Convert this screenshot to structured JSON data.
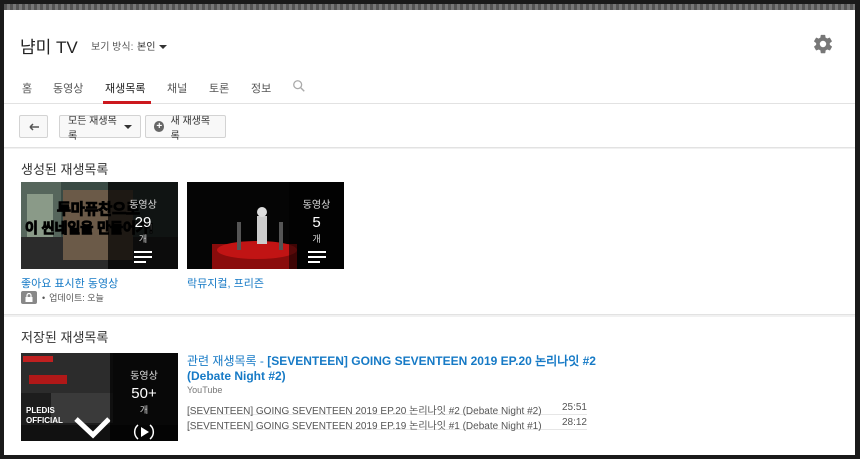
{
  "header": {
    "channel_title": "냠미 TV",
    "view_as_label": "보기 방식:",
    "view_as_value": "본인"
  },
  "tabs": [
    {
      "label": "홈"
    },
    {
      "label": "동영상"
    },
    {
      "label": "재생목록"
    },
    {
      "label": "채널"
    },
    {
      "label": "토론"
    },
    {
      "label": "정보"
    }
  ],
  "toolbar": {
    "all_playlists": "모든 재생목록",
    "new_playlist": "새 재생목록"
  },
  "created": {
    "section_title": "생성된 재생목록",
    "playlists": [
      {
        "title": "좋아요 표시한 동영상",
        "count_label": "동영상",
        "count": "29",
        "unit": "개",
        "meta": "업데이트: 오늘",
        "thumb_caption_1": "투마퓨찬으로",
        "thumb_caption_2": "이 씬네일을 만들어가!"
      },
      {
        "title": "락뮤지컬, 프리즌",
        "count_label": "동영상",
        "count": "5",
        "unit": "개"
      }
    ]
  },
  "saved": {
    "section_title": "저장된 재생목록",
    "playlist": {
      "title_prefix": "관련 재생목록 - ",
      "title_main": "[SEVENTEEN] GOING SEVENTEEN 2019 EP.20 논리나잇 #2 (Debate Night #2)",
      "owner": "YouTube",
      "count_label": "동영상",
      "count": "50+",
      "unit": "개",
      "thumb_brand": "PLEDIS OFFICIAL",
      "videos": [
        {
          "title": "[SEVENTEEN] GOING SEVENTEEN 2019 EP.20 논리나잇 #2 (Debate Night #2)",
          "duration": "25:51"
        },
        {
          "title": "[SEVENTEEN] GOING SEVENTEEN 2019 EP.19 논리나잇 #1 (Debate Night #1)",
          "duration": "28:12"
        }
      ]
    }
  },
  "colors": {
    "accent_red": "#cc181e",
    "link_blue": "#167ac6"
  }
}
